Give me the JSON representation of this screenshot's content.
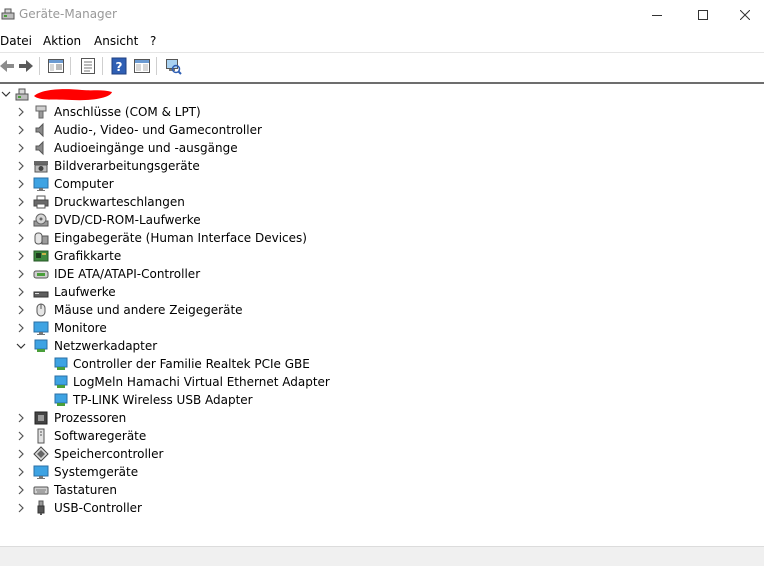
{
  "window": {
    "title": "Geräte-Manager",
    "controls": {
      "minimize_icon": "minimize-icon",
      "maximize_icon": "maximize-icon",
      "close_icon": "close-icon"
    }
  },
  "menu": [
    "Datei",
    "Aktion",
    "Ansicht",
    "?"
  ],
  "toolbar": {
    "buttons": [
      "back-arrow-icon",
      "forward-arrow-icon",
      "show-hide-tree-icon",
      "properties-icon",
      "help-icon",
      "view-icon",
      "scan-hardware-icon"
    ]
  },
  "tree": {
    "root": {
      "expanded": true,
      "label_redacted": true,
      "icon": "computer-root-icon",
      "redaction_color": "#ff0000"
    },
    "categories": [
      {
        "label": "Anschlüsse (COM & LPT)",
        "icon": "port-icon",
        "expanded": false
      },
      {
        "label": "Audio-, Video- und Gamecontroller",
        "icon": "speaker-icon",
        "expanded": false
      },
      {
        "label": "Audioeingänge und -ausgänge",
        "icon": "speaker-icon",
        "expanded": false
      },
      {
        "label": "Bildverarbeitungsgeräte",
        "icon": "camera-icon",
        "expanded": false
      },
      {
        "label": "Computer",
        "icon": "monitor-icon",
        "expanded": false
      },
      {
        "label": "Druckwarteschlangen",
        "icon": "printer-icon",
        "expanded": false
      },
      {
        "label": "DVD/CD-ROM-Laufwerke",
        "icon": "disc-icon",
        "expanded": false
      },
      {
        "label": "Eingabegeräte (Human Interface Devices)",
        "icon": "hid-icon",
        "expanded": false
      },
      {
        "label": "Grafikkarte",
        "icon": "graphics-card-icon",
        "expanded": false
      },
      {
        "label": "IDE ATA/ATAPI-Controller",
        "icon": "ide-controller-icon",
        "expanded": false
      },
      {
        "label": "Laufwerke",
        "icon": "drive-icon",
        "expanded": false
      },
      {
        "label": "Mäuse und andere Zeigegeräte",
        "icon": "mouse-icon",
        "expanded": false
      },
      {
        "label": "Monitore",
        "icon": "monitor-icon",
        "expanded": false
      },
      {
        "label": "Netzwerkadapter",
        "icon": "network-adapter-icon",
        "expanded": true,
        "children": [
          {
            "label": "Controller der Familie Realtek PCIe GBE",
            "icon": "network-adapter-icon"
          },
          {
            "label": "LogMeln Hamachi Virtual Ethernet Adapter",
            "icon": "network-adapter-icon"
          },
          {
            "label": "TP-LINK Wireless USB Adapter",
            "icon": "network-adapter-icon"
          }
        ]
      },
      {
        "label": "Prozessoren",
        "icon": "processor-icon",
        "expanded": false
      },
      {
        "label": "Softwaregeräte",
        "icon": "software-device-icon",
        "expanded": false
      },
      {
        "label": "Speichercontroller",
        "icon": "storage-controller-icon",
        "expanded": false
      },
      {
        "label": "Systemgeräte",
        "icon": "monitor-icon",
        "expanded": false
      },
      {
        "label": "Tastaturen",
        "icon": "keyboard-icon",
        "expanded": false
      },
      {
        "label": "USB-Controller",
        "icon": "usb-icon",
        "expanded": false
      }
    ]
  },
  "colors": {
    "title_text": "#999999",
    "tree_border": "#6d6d6d",
    "status_bar": "#f0f0f0",
    "network_icon": "#2e8bd6"
  }
}
